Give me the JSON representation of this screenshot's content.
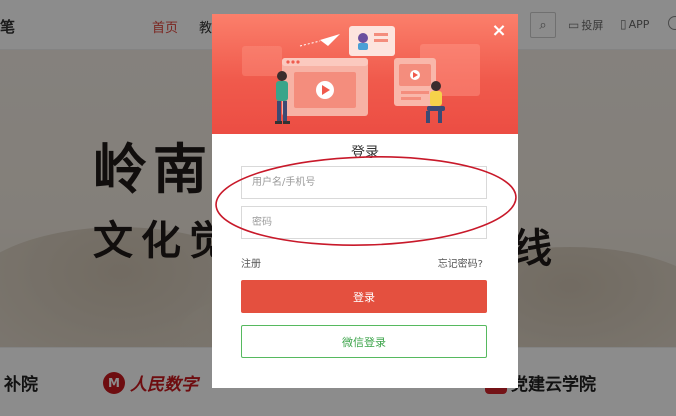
{
  "header": {
    "brand_fragment": "笔",
    "nav_home": "首页",
    "nav_next_fragment": "教",
    "links": [
      {
        "icon": "monitor-icon",
        "label": "投屏"
      },
      {
        "icon": "phone-icon",
        "label": "APP"
      }
    ]
  },
  "banner": {
    "title_line1": "岭南",
    "title_line2": "文化觉",
    "title_line2_end": "线"
  },
  "partners": {
    "left_fragment": "补院",
    "rm_logo_char": "M",
    "rm_text": "人民数字",
    "right_text": "党建云学院"
  },
  "login_modal": {
    "close_symbol": "×",
    "title": "登录",
    "username_placeholder": "用户名/手机号",
    "password_placeholder": "密码",
    "register_link": "注册",
    "forgot_link": "忘记密码?",
    "login_button": "登录",
    "wechat_button": "微信登录"
  },
  "colors": {
    "brand_red": "#e4503f",
    "wechat_green": "#3da44b",
    "annotation_red": "#c8192a"
  }
}
